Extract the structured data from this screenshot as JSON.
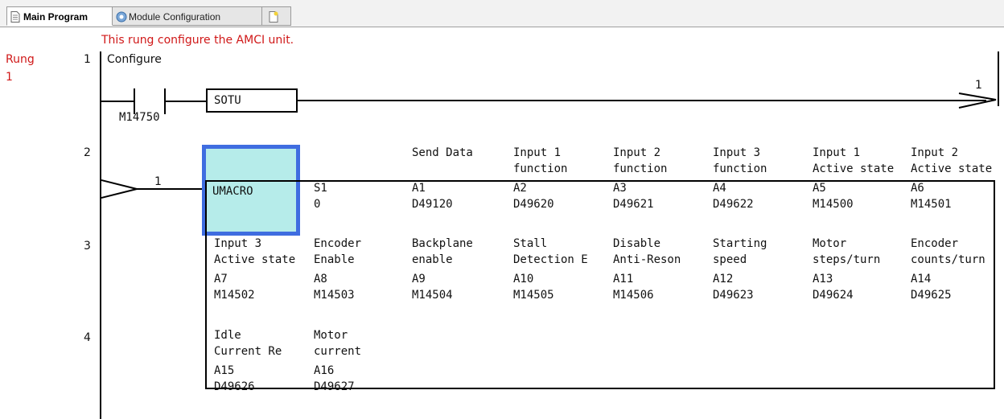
{
  "tabs": [
    {
      "label": "Main Program",
      "icon": "document-icon",
      "active": true
    },
    {
      "label": "Module Configuration",
      "icon": "module-config-icon",
      "active": false
    },
    {
      "label": "",
      "icon": "new-tab-icon",
      "active": false
    }
  ],
  "rung": {
    "comment": "This rung configure the AMCI unit.",
    "label": "Rung",
    "number": "1",
    "title": "Configure",
    "line_numbers": [
      "1",
      "2",
      "3",
      "4"
    ]
  },
  "contact": {
    "address": "M14750"
  },
  "output": {
    "instruction": "SOTU",
    "connector": "1"
  },
  "branch_connector": "1",
  "macro": {
    "name": "UMACRO",
    "params": [
      {
        "desc1": "",
        "desc2": "",
        "param": "S1",
        "value": "0"
      },
      {
        "desc1": "Send Data",
        "desc2": "",
        "param": "A1",
        "value": "D49120"
      },
      {
        "desc1": "Input 1",
        "desc2": "function",
        "param": "A2",
        "value": "D49620"
      },
      {
        "desc1": "Input 2",
        "desc2": "function",
        "param": "A3",
        "value": "D49621"
      },
      {
        "desc1": "Input 3",
        "desc2": "function",
        "param": "A4",
        "value": "D49622"
      },
      {
        "desc1": "Input 1",
        "desc2": "Active state",
        "param": "A5",
        "value": "M14500"
      },
      {
        "desc1": "Input 2",
        "desc2": "Active state",
        "param": "A6",
        "value": "M14501"
      },
      {
        "desc1": "Input 3",
        "desc2": "Active state",
        "param": "A7",
        "value": "M14502"
      },
      {
        "desc1": "Encoder",
        "desc2": "Enable",
        "param": "A8",
        "value": "M14503"
      },
      {
        "desc1": "Backplane",
        "desc2": "enable",
        "param": "A9",
        "value": "M14504"
      },
      {
        "desc1": "Stall",
        "desc2": "Detection E",
        "param": "A10",
        "value": "M14505"
      },
      {
        "desc1": "Disable",
        "desc2": "Anti-Reson",
        "param": "A11",
        "value": "M14506"
      },
      {
        "desc1": "Starting",
        "desc2": "speed",
        "param": "A12",
        "value": "D49623"
      },
      {
        "desc1": "Motor",
        "desc2": "steps/turn",
        "param": "A13",
        "value": "D49624"
      },
      {
        "desc1": "Encoder",
        "desc2": "counts/turn",
        "param": "A14",
        "value": "D49625"
      },
      {
        "desc1": "Idle",
        "desc2": "Current Re",
        "param": "A15",
        "value": "D49626"
      },
      {
        "desc1": "Motor",
        "desc2": "current",
        "param": "A16",
        "value": "D49627"
      }
    ]
  },
  "colors": {
    "comment": "#d01818",
    "selection_border": "#3f6de0",
    "selection_fill": "#b6ecea"
  }
}
